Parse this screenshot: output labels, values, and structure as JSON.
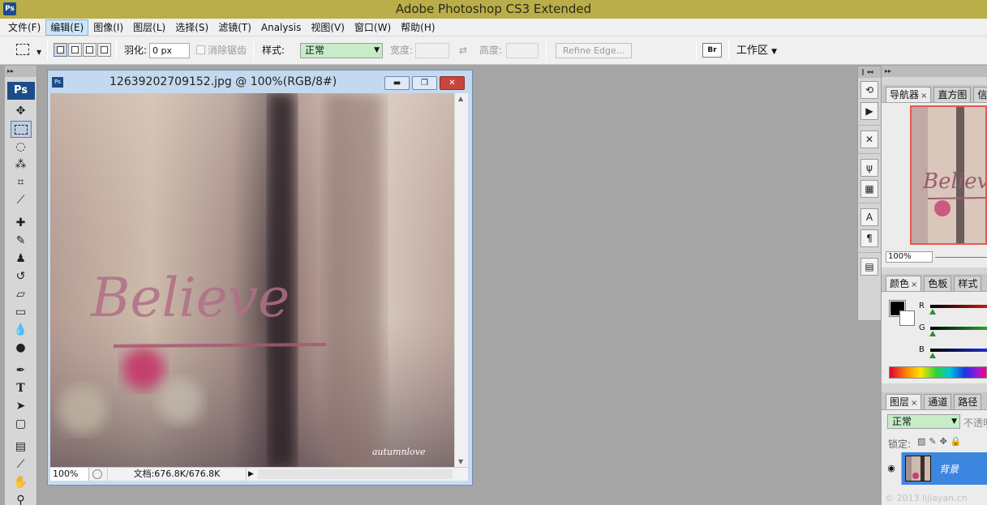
{
  "app": {
    "title": "Adobe Photoshop CS3 Extended",
    "logo": "Ps"
  },
  "menu": [
    "文件(F)",
    "编辑(E)",
    "图像(I)",
    "图层(L)",
    "选择(S)",
    "滤镜(T)",
    "Analysis",
    "视图(V)",
    "窗口(W)",
    "帮助(H)"
  ],
  "menu_active_index": 1,
  "options": {
    "feather_label": "羽化:",
    "feather_value": "0 px",
    "antialias_label": "消除锯齿",
    "style_label": "样式:",
    "style_value": "正常",
    "width_label": "宽度:",
    "height_label": "高度:",
    "refine_edge_label": "Refine Edge...",
    "workspace_label": "工作区",
    "bridge_label": "Br"
  },
  "tools": {
    "badge": "Ps",
    "items": [
      "move-icon",
      "marquee-icon",
      "lasso-icon",
      "magic-wand-icon",
      "crop-icon",
      "slice-icon",
      "healing-brush-icon",
      "brush-icon",
      "clone-stamp-icon",
      "history-brush-icon",
      "eraser-icon",
      "gradient-icon",
      "blur-icon",
      "dodge-icon",
      "pen-icon",
      "type-icon",
      "path-select-icon",
      "rectangle-icon",
      "notes-icon",
      "eyedropper-icon",
      "hand-icon",
      "zoom-icon"
    ],
    "type_glyph": "T"
  },
  "document": {
    "title": "12639202709152.jpg @ 100%(RGB/8#)",
    "zoom": "100%",
    "doc_info": "文档:676.8K/676.8K",
    "image_text": "Believe",
    "watermark": "autumnlove"
  },
  "navigator": {
    "tabs": [
      "导航器",
      "直方图",
      "信"
    ],
    "zoom": "100%"
  },
  "color_panel": {
    "tabs": [
      "颜色",
      "色板",
      "样式"
    ],
    "channels": [
      "R",
      "G",
      "B"
    ],
    "channel_colors": [
      "#c81818",
      "#1faa1f",
      "#1c2fd6"
    ]
  },
  "layers": {
    "tabs": [
      "图层",
      "通道",
      "路径"
    ],
    "blend_mode": "正常",
    "opacity_label": "不透明",
    "lock_label": "锁定:",
    "layer_name": "背景"
  },
  "copyright": "© 2013 lijiayan.cn"
}
